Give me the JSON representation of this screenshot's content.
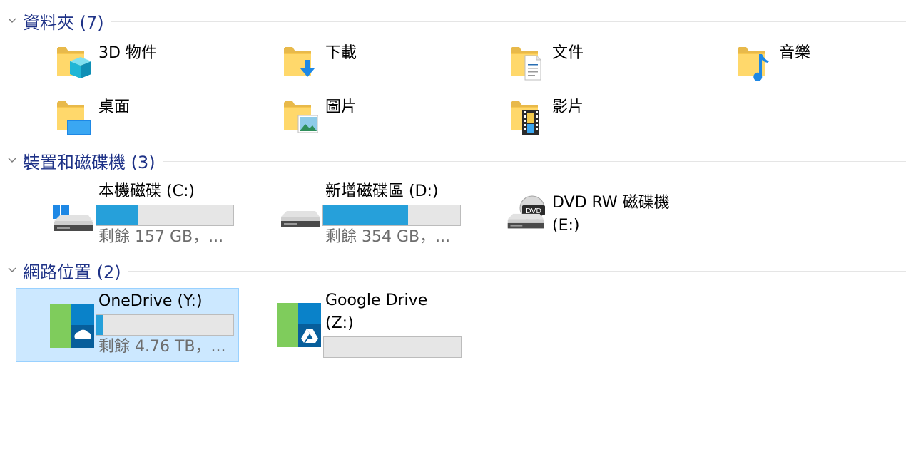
{
  "sections": {
    "folders": {
      "title": "資料夾 (7)",
      "items": [
        {
          "label": "3D 物件",
          "icon": "3d-objects-folder-icon"
        },
        {
          "label": "下載",
          "icon": "downloads-folder-icon"
        },
        {
          "label": "文件",
          "icon": "documents-folder-icon"
        },
        {
          "label": "音樂",
          "icon": "music-folder-icon"
        },
        {
          "label": "桌面",
          "icon": "desktop-folder-icon"
        },
        {
          "label": "圖片",
          "icon": "pictures-folder-icon"
        },
        {
          "label": "影片",
          "icon": "videos-folder-icon"
        }
      ]
    },
    "drives": {
      "title": "裝置和磁碟機 (3)",
      "items": [
        {
          "label": "本機磁碟 (C:)",
          "free": "剩餘 157 GB，...",
          "used_fraction": 0.3,
          "icon": "windows-drive-icon"
        },
        {
          "label": "新增磁碟區 (D:)",
          "free": "剩餘 354 GB，...",
          "used_fraction": 0.62,
          "icon": "hard-drive-icon"
        },
        {
          "label": "DVD RW 磁碟機",
          "label2": "(E:)",
          "icon": "dvd-drive-icon"
        }
      ]
    },
    "network": {
      "title": "網路位置 (2)",
      "items": [
        {
          "label": "OneDrive (Y:)",
          "free": "剩餘 4.76 TB，...",
          "used_fraction": 0.05,
          "icon": "onedrive-icon"
        },
        {
          "label": "Google Drive",
          "label2": "(Z:)",
          "used_fraction": 0.0,
          "icon": "google-drive-icon"
        }
      ]
    }
  },
  "colors": {
    "section_title": "#1e3287",
    "selection_bg": "#cce8ff",
    "bar_fill": "#26a0da",
    "folder": "#ffd86b"
  }
}
